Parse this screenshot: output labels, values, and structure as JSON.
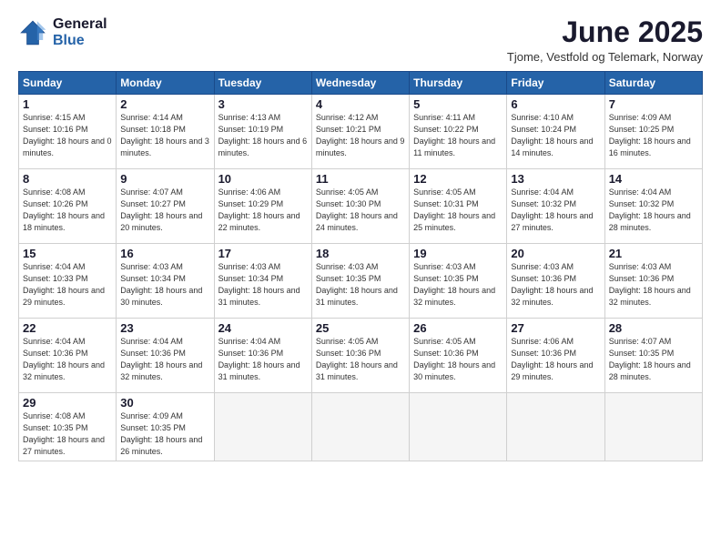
{
  "logo": {
    "general": "General",
    "blue": "Blue"
  },
  "title": "June 2025",
  "location": "Tjome, Vestfold og Telemark, Norway",
  "weekdays": [
    "Sunday",
    "Monday",
    "Tuesday",
    "Wednesday",
    "Thursday",
    "Friday",
    "Saturday"
  ],
  "days": [
    {
      "num": "1",
      "sunrise": "4:15 AM",
      "sunset": "10:16 PM",
      "daylight": "18 hours and 0 minutes."
    },
    {
      "num": "2",
      "sunrise": "4:14 AM",
      "sunset": "10:18 PM",
      "daylight": "18 hours and 3 minutes."
    },
    {
      "num": "3",
      "sunrise": "4:13 AM",
      "sunset": "10:19 PM",
      "daylight": "18 hours and 6 minutes."
    },
    {
      "num": "4",
      "sunrise": "4:12 AM",
      "sunset": "10:21 PM",
      "daylight": "18 hours and 9 minutes."
    },
    {
      "num": "5",
      "sunrise": "4:11 AM",
      "sunset": "10:22 PM",
      "daylight": "18 hours and 11 minutes."
    },
    {
      "num": "6",
      "sunrise": "4:10 AM",
      "sunset": "10:24 PM",
      "daylight": "18 hours and 14 minutes."
    },
    {
      "num": "7",
      "sunrise": "4:09 AM",
      "sunset": "10:25 PM",
      "daylight": "18 hours and 16 minutes."
    },
    {
      "num": "8",
      "sunrise": "4:08 AM",
      "sunset": "10:26 PM",
      "daylight": "18 hours and 18 minutes."
    },
    {
      "num": "9",
      "sunrise": "4:07 AM",
      "sunset": "10:27 PM",
      "daylight": "18 hours and 20 minutes."
    },
    {
      "num": "10",
      "sunrise": "4:06 AM",
      "sunset": "10:29 PM",
      "daylight": "18 hours and 22 minutes."
    },
    {
      "num": "11",
      "sunrise": "4:05 AM",
      "sunset": "10:30 PM",
      "daylight": "18 hours and 24 minutes."
    },
    {
      "num": "12",
      "sunrise": "4:05 AM",
      "sunset": "10:31 PM",
      "daylight": "18 hours and 25 minutes."
    },
    {
      "num": "13",
      "sunrise": "4:04 AM",
      "sunset": "10:32 PM",
      "daylight": "18 hours and 27 minutes."
    },
    {
      "num": "14",
      "sunrise": "4:04 AM",
      "sunset": "10:32 PM",
      "daylight": "18 hours and 28 minutes."
    },
    {
      "num": "15",
      "sunrise": "4:04 AM",
      "sunset": "10:33 PM",
      "daylight": "18 hours and 29 minutes."
    },
    {
      "num": "16",
      "sunrise": "4:03 AM",
      "sunset": "10:34 PM",
      "daylight": "18 hours and 30 minutes."
    },
    {
      "num": "17",
      "sunrise": "4:03 AM",
      "sunset": "10:34 PM",
      "daylight": "18 hours and 31 minutes."
    },
    {
      "num": "18",
      "sunrise": "4:03 AM",
      "sunset": "10:35 PM",
      "daylight": "18 hours and 31 minutes."
    },
    {
      "num": "19",
      "sunrise": "4:03 AM",
      "sunset": "10:35 PM",
      "daylight": "18 hours and 32 minutes."
    },
    {
      "num": "20",
      "sunrise": "4:03 AM",
      "sunset": "10:36 PM",
      "daylight": "18 hours and 32 minutes."
    },
    {
      "num": "21",
      "sunrise": "4:03 AM",
      "sunset": "10:36 PM",
      "daylight": "18 hours and 32 minutes."
    },
    {
      "num": "22",
      "sunrise": "4:04 AM",
      "sunset": "10:36 PM",
      "daylight": "18 hours and 32 minutes."
    },
    {
      "num": "23",
      "sunrise": "4:04 AM",
      "sunset": "10:36 PM",
      "daylight": "18 hours and 32 minutes."
    },
    {
      "num": "24",
      "sunrise": "4:04 AM",
      "sunset": "10:36 PM",
      "daylight": "18 hours and 31 minutes."
    },
    {
      "num": "25",
      "sunrise": "4:05 AM",
      "sunset": "10:36 PM",
      "daylight": "18 hours and 31 minutes."
    },
    {
      "num": "26",
      "sunrise": "4:05 AM",
      "sunset": "10:36 PM",
      "daylight": "18 hours and 30 minutes."
    },
    {
      "num": "27",
      "sunrise": "4:06 AM",
      "sunset": "10:36 PM",
      "daylight": "18 hours and 29 minutes."
    },
    {
      "num": "28",
      "sunrise": "4:07 AM",
      "sunset": "10:35 PM",
      "daylight": "18 hours and 28 minutes."
    },
    {
      "num": "29",
      "sunrise": "4:08 AM",
      "sunset": "10:35 PM",
      "daylight": "18 hours and 27 minutes."
    },
    {
      "num": "30",
      "sunrise": "4:09 AM",
      "sunset": "10:35 PM",
      "daylight": "18 hours and 26 minutes."
    }
  ]
}
